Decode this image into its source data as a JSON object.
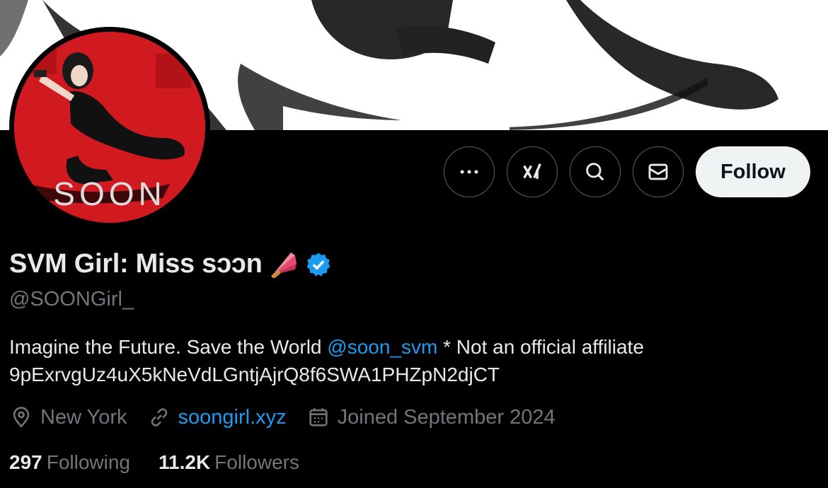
{
  "profile": {
    "display_name": "SVM Girl: Miss sɔɔn",
    "handle": "@SOONGirl_",
    "avatar_text": "SOON",
    "verified": true,
    "accent_color": "#1d9bf0"
  },
  "bio": {
    "text_before": "Imagine the Future. Save the World ",
    "mention": "@soon_svm",
    "text_after": " * Not an official affiliate",
    "line2": "9pExrvgUz4uX5kNeVdLGntjAjrQ8f6SWA1PHZpN2djCT"
  },
  "meta": {
    "location": "New York",
    "website": "soongirl.xyz",
    "joined": "Joined September 2024"
  },
  "stats": {
    "following_count": "297",
    "following_label": "Following",
    "followers_count": "11.2K",
    "followers_label": "Followers"
  },
  "actions": {
    "follow_label": "Follow",
    "icons": [
      "more-icon",
      "grok-icon",
      "search-icon",
      "message-icon"
    ]
  }
}
